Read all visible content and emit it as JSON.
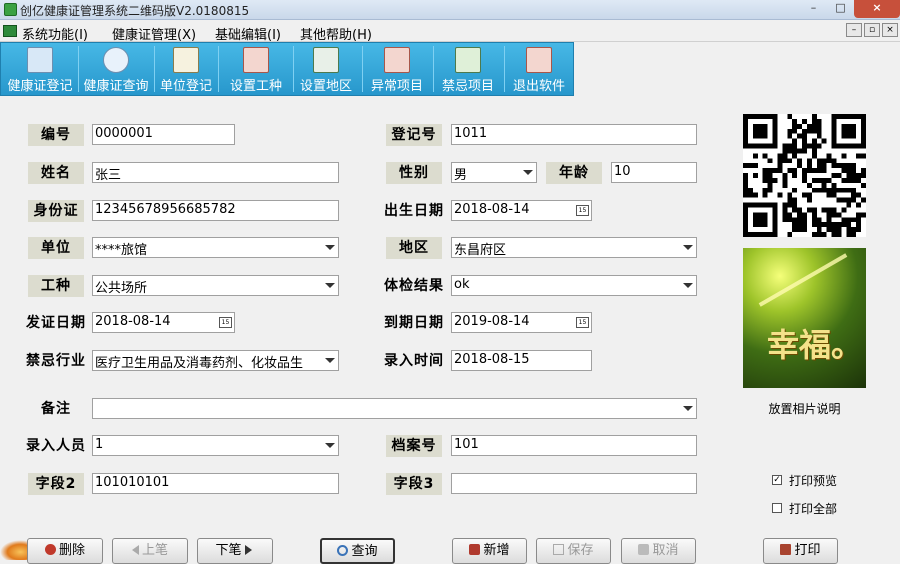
{
  "window": {
    "title": "创亿健康证管理系统二维码版V2.0180815",
    "minimize": "–",
    "maximize": "□",
    "close": "×"
  },
  "menu": [
    "系统功能(I)",
    "健康证管理(X)",
    "基础编辑(I)",
    "其他帮助(H)"
  ],
  "mdi_buttons": [
    "–",
    "▫",
    "×"
  ],
  "toolbar": [
    {
      "label": "健康证登记",
      "icon": "register-icon",
      "color": "#d8e8f7"
    },
    {
      "label": "健康证查询",
      "icon": "search-icon",
      "color": "#e8f2fb"
    },
    {
      "label": "单位登记",
      "icon": "building-icon",
      "color": "#f6f2df"
    },
    {
      "label": "设置工种",
      "icon": "edit-icon",
      "color": "#f3d6cf"
    },
    {
      "label": "设置地区",
      "icon": "map-icon",
      "color": "#e8f0e8"
    },
    {
      "label": "异常项目",
      "icon": "warning-edit-icon",
      "color": "#f3d6cf"
    },
    {
      "label": "禁忌项目",
      "icon": "person-card-icon",
      "color": "#dff0d8"
    },
    {
      "label": "退出软件",
      "icon": "exit-icon",
      "color": "#f3d6cf"
    }
  ],
  "form": {
    "bianhao_label": "编号",
    "bianhao": "0000001",
    "dengjihao_label": "登记号",
    "dengjihao": "1011",
    "xingming_label": "姓名",
    "xingming": "张三",
    "xingbie_label": "性别",
    "xingbie": "男",
    "nianling_label": "年龄",
    "nianling": "10",
    "shenfenzheng_label": "身份证",
    "shenfenzheng": "12345678956685782",
    "chusheng_label": "出生日期",
    "chusheng": "2018-08-14",
    "danwei_label": "单位",
    "danwei": "****旅馆",
    "diqu_label": "地区",
    "diqu": "东昌府区",
    "gongzhong_label": "工种",
    "gongzhong": "公共场所",
    "tijian_label": "体检结果",
    "tijian": "ok",
    "fazheng_label": "发证日期",
    "fazheng": "2018-08-14",
    "daoqi_label": "到期日期",
    "daoqi": "2019-08-14",
    "jinji_label": "禁忌行业",
    "jinji": "医疗卫生用品及消毒药剂、化妆品生",
    "luru_time_label": "录入时间",
    "luru_time": "2018-08-15",
    "beizhu_label": "备注",
    "beizhu": "",
    "luru_person_label": "录入人员",
    "luru_person": "1",
    "dangan_label": "档案号",
    "dangan": "101",
    "ziduan2_label": "字段2",
    "ziduan2": "101010101",
    "ziduan3_label": "字段3",
    "ziduan3": ""
  },
  "calendar_glyph": "15",
  "photo": {
    "text": "幸福。",
    "caption": "放置相片说明"
  },
  "options": {
    "print_preview_label": "打印预览",
    "print_preview_checked": true,
    "print_all_label": "打印全部",
    "print_all_checked": false,
    "check_mark": "✓"
  },
  "buttons": {
    "delete": "删除",
    "prev": "上笔",
    "next": "下笔",
    "query": "查询",
    "add": "新增",
    "save": "保存",
    "cancel": "取消",
    "print": "打印"
  }
}
